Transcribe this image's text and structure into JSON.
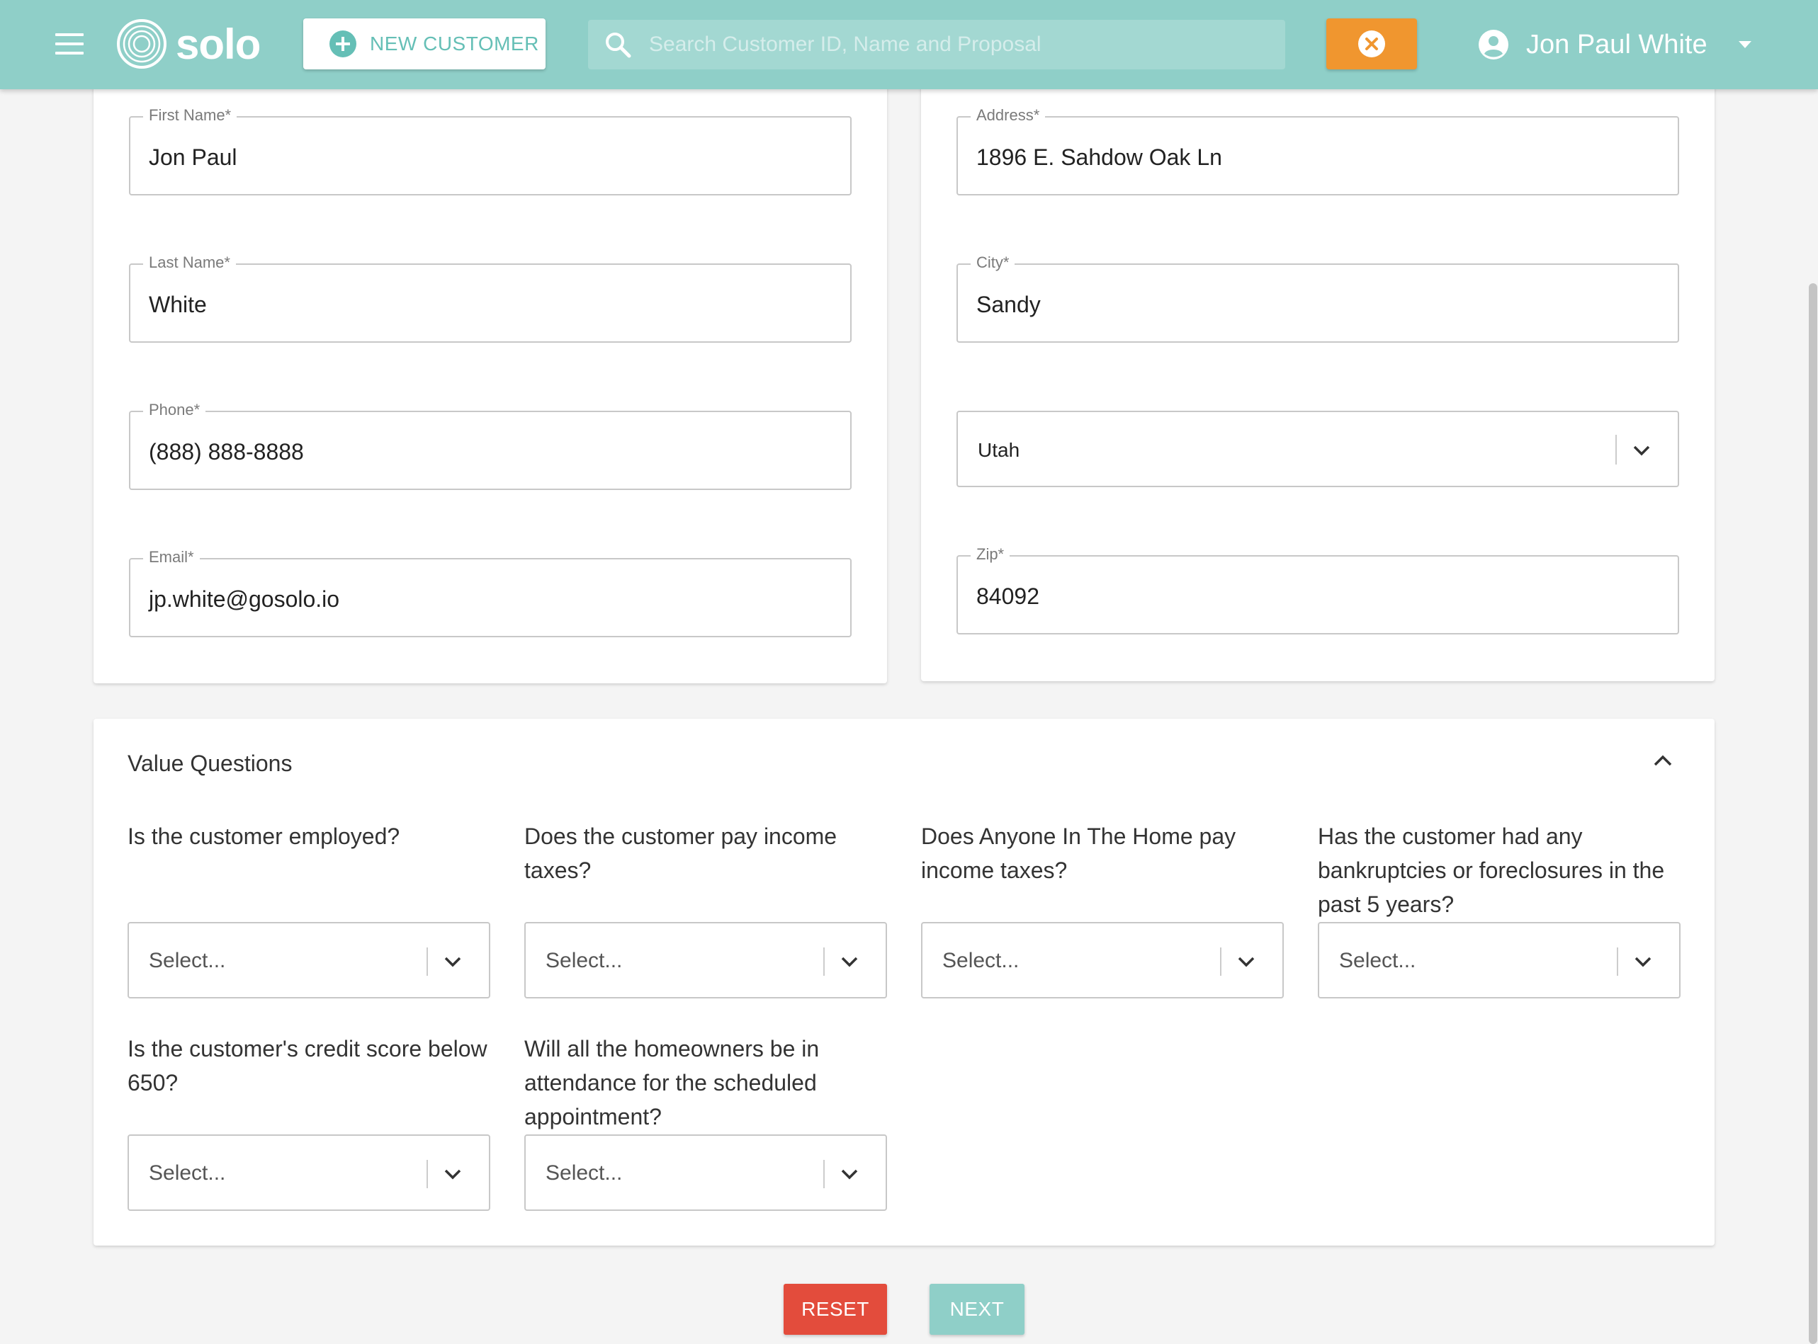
{
  "header": {
    "brand": "solo",
    "new_customer_label": "NEW CUSTOMER",
    "search_placeholder": "Search Customer ID, Name and Proposal",
    "user_name": "Jon Paul White",
    "icons": [
      "menu-icon",
      "solo-logo-icon",
      "plus-circle-icon",
      "search-icon",
      "close-circle-icon",
      "user-avatar-icon",
      "caret-down-icon"
    ]
  },
  "customer": {
    "first_name": {
      "label": "First Name*",
      "value": "Jon Paul"
    },
    "last_name": {
      "label": "Last Name*",
      "value": "White"
    },
    "phone": {
      "label": "Phone*",
      "value": "(888) 888-8888"
    },
    "email": {
      "label": "Email*",
      "value": "jp.white@gosolo.io"
    }
  },
  "address": {
    "street": {
      "label": "Address*",
      "value": "1896 E. Sahdow Oak Ln"
    },
    "city": {
      "label": "City*",
      "value": "Sandy"
    },
    "state": {
      "value": "Utah"
    },
    "zip": {
      "label": "Zip*",
      "value": "84092"
    }
  },
  "value_questions": {
    "title": "Value Questions",
    "placeholder": "Select...",
    "questions": [
      "Is the customer employed?",
      "Does the customer pay income taxes?",
      "Does Anyone In The Home pay income taxes?",
      "Has the customer had any bankruptcies or foreclosures in the past 5 years?",
      "Is the customer's credit score below 650?",
      "Will all the homeowners be in attendance for the scheduled appointment?"
    ]
  },
  "actions": {
    "reset": "RESET",
    "next": "NEXT"
  },
  "colors": {
    "header": "#8fcfc8",
    "accent": "#65bfb6",
    "clear": "#f0962f",
    "reset": "#e34c3c"
  }
}
